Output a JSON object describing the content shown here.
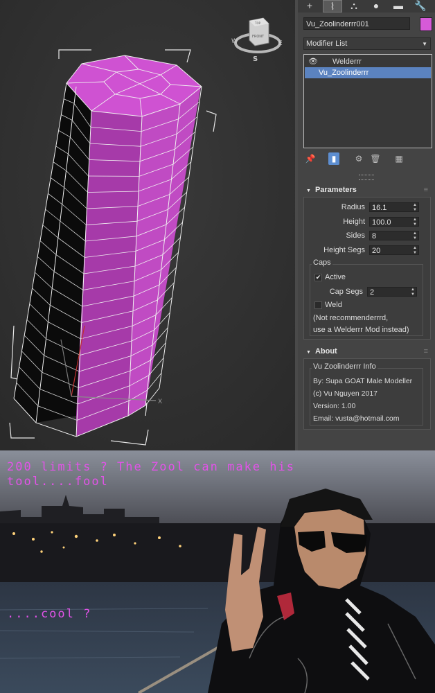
{
  "viewport": {
    "viewcube_face": "FRONT",
    "viewcube_top": "TOP",
    "compass": {
      "w": "W",
      "e": "E",
      "s": "S"
    },
    "axis_x": "X"
  },
  "tabs": [
    {
      "icon": "plus-icon",
      "glyph": "+"
    },
    {
      "icon": "modify-icon",
      "glyph": "⌇"
    },
    {
      "icon": "hierarchy-icon",
      "glyph": "⛬"
    },
    {
      "icon": "motion-icon",
      "glyph": "●"
    },
    {
      "icon": "display-icon",
      "glyph": "▬"
    },
    {
      "icon": "utilities-icon",
      "glyph": "🔧"
    }
  ],
  "object": {
    "name": "Vu_Zoolinderrr001",
    "color": "#d65ad8"
  },
  "modifier_list_label": "Modifier List",
  "stack": [
    {
      "label": "Welderrr",
      "selected": false
    },
    {
      "label": "Vu_Zoolinderrr",
      "selected": true
    }
  ],
  "parameters": {
    "title": "Parameters",
    "radius_label": "Radius",
    "radius": "16.1",
    "height_label": "Height",
    "height": "100.0",
    "sides_label": "Sides",
    "sides": "8",
    "height_segs_label": "Height Segs",
    "height_segs": "20",
    "caps_title": "Caps",
    "active_label": "Active",
    "cap_segs_label": "Cap Segs",
    "cap_segs": "2",
    "weld_label": "Weld",
    "note_line1": "(Not recommenderrrd,",
    "note_line2": "use a Welderrr Mod instead)"
  },
  "about": {
    "title": "About",
    "group_title": "Vu  Zoolinderrr Info",
    "by": "By: Supa GOAT Male Modeller",
    "copyright": "(c) Vu Nguyen 2017",
    "version": "Version: 1.00",
    "email": "Email: vusta@hotmail.com"
  },
  "meme": {
    "line1": "200 limits ? The Zool can make his",
    "line2": "tool....fool",
    "line3": "....cool ?",
    "color": "#e253e8"
  }
}
